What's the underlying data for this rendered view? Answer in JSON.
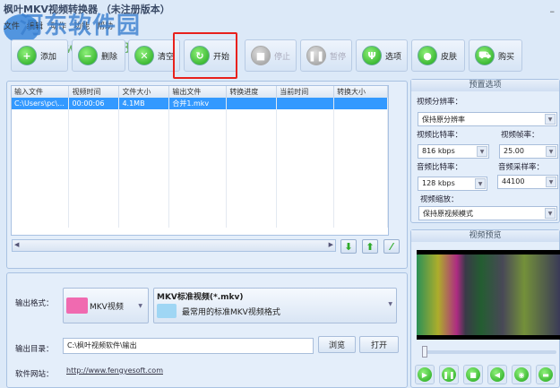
{
  "window": {
    "title": "枫叶MKV视频转换器 （未注册版本）",
    "minimize": "–"
  },
  "watermark": {
    "name": "河东软件园",
    "url": "www.pc0359.cn"
  },
  "menu": [
    "文件",
    "编辑",
    "动作",
    "功能",
    "帮助"
  ],
  "toolbar": [
    {
      "label": "添加",
      "icon": "plus-icon",
      "glyph": "+",
      "enabled": true
    },
    {
      "label": "删除",
      "icon": "minus-icon",
      "glyph": "−",
      "enabled": true
    },
    {
      "label": "清空",
      "icon": "clear-icon",
      "glyph": "✕",
      "enabled": true
    },
    {
      "label": "开始",
      "icon": "refresh-icon",
      "glyph": "↻",
      "enabled": true
    },
    {
      "label": "停止",
      "icon": "stop-icon",
      "glyph": "■",
      "enabled": false
    },
    {
      "label": "暂停",
      "icon": "pause-icon",
      "glyph": "❚❚",
      "enabled": false
    },
    {
      "label": "选项",
      "icon": "options-icon",
      "glyph": "Ψ",
      "enabled": true
    },
    {
      "label": "皮肤",
      "icon": "apple-icon",
      "glyph": "●",
      "enabled": true
    },
    {
      "label": "购买",
      "icon": "cart-icon",
      "glyph": "⛟",
      "enabled": true
    }
  ],
  "filelist": {
    "columns": [
      "输入文件",
      "视频时间",
      "文件大小",
      "输出文件",
      "转换进度",
      "当前时间",
      "转换大小"
    ],
    "rows": [
      [
        "C:\\Users\\pc\\...",
        "00:00:06",
        "4.1MB",
        "合并1.mkv",
        "",
        "",
        ""
      ]
    ]
  },
  "output": {
    "format_label": "输出格式：",
    "format_value": "MKV视频",
    "profile_title": "MKV标准视频(*.mkv)",
    "profile_desc": "最常用的标准MKV视频格式",
    "dir_label": "输出目录：",
    "dir_value": "C:\\枫叶视频软件\\输出",
    "browse": "浏览",
    "open": "打开",
    "site_label": "软件网站：",
    "site_url": "http://www.fengyesoft.com"
  },
  "preset": {
    "title": "预置选项",
    "resolution_label": "视频分辨率：",
    "resolution": "保持原分辨率",
    "vbitrate_label": "视频比特率：",
    "vbitrate": "816 kbps",
    "framerate_label": "视频帧率：",
    "framerate": "25.00",
    "abitrate_label": "音频比特率：",
    "abitrate": "128 kbps",
    "samplerate_label": "音频采样率：",
    "samplerate": "44100",
    "scale_label": "视频缩放：",
    "scale": "保持原视频模式"
  },
  "preview": {
    "title": "视频预览",
    "position": 0
  }
}
